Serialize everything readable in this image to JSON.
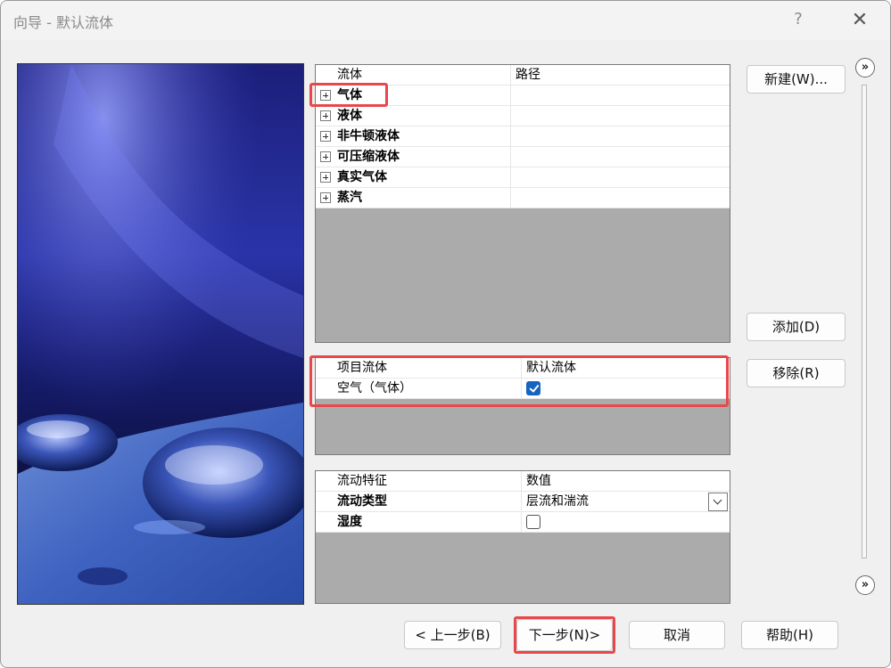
{
  "window": {
    "title": "向导 - 默认流体",
    "help": "?",
    "close": "✕"
  },
  "fluids": {
    "headers": [
      "流体",
      "路径"
    ],
    "groups": [
      "气体",
      "液体",
      "非牛顿液体",
      "可压缩液体",
      "真实气体",
      "蒸汽"
    ]
  },
  "project": {
    "headers": [
      "项目流体",
      "默认流体"
    ],
    "rows": [
      {
        "name": "空气（气体）",
        "default": true
      }
    ]
  },
  "flow": {
    "headers": [
      "流动特征",
      "数值"
    ],
    "rows": [
      {
        "name": "流动类型",
        "value": "层流和湍流"
      },
      {
        "name": "湿度",
        "checked": false
      }
    ]
  },
  "side_buttons": {
    "new": "新建(W)...",
    "add": "添加(D)",
    "remove": "移除(R)"
  },
  "bottom_buttons": {
    "back": "< 上一步(B)",
    "next": "下一步(N)>",
    "cancel": "取消",
    "help": "帮助(H)"
  },
  "scroll": {
    "up": "»",
    "down": "»"
  },
  "colors": {
    "highlight": "#e8474b",
    "checkbox": "#1565c0",
    "panel_gray": "#ababab"
  }
}
